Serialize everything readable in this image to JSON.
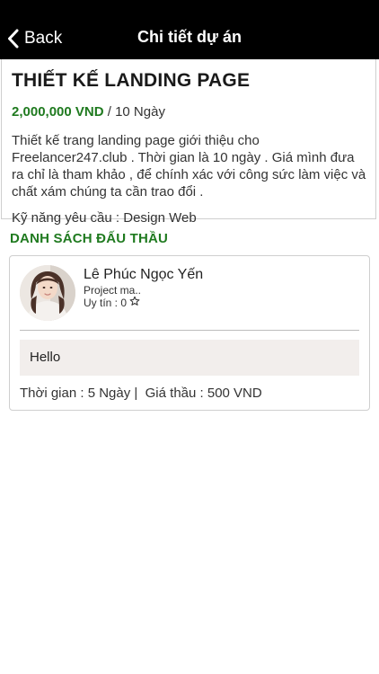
{
  "navbar": {
    "back_label": "Back",
    "title": "Chi tiết dự án",
    "back_icon": "chevron-left-icon"
  },
  "project": {
    "title": "THIẾT KẾ LANDING PAGE",
    "price": "2,000,000 VND",
    "duration": " / 10 Ngày",
    "description": "Thiết kế trang landing page giới thiệu cho Freelancer247.club . Thời gian là 10 ngày . Giá mình đưa ra chỉ là tham khảo , để chính xác với công sức làm việc và chất xám chúng ta cần trao đổi .",
    "skills": "Kỹ năng yêu cầu : Design Web"
  },
  "bids": {
    "heading": "DANH SÁCH ĐẤU THẦU",
    "items": [
      {
        "name": "Lê Phúc Ngọc Yến",
        "role": "Project ma..",
        "rating": "Uy tín : 0",
        "rating_icon": "star-outline-icon",
        "message": "Hello",
        "time": "Thời gian : 5 Ngày |",
        "bid_price": "Giá thầu : 500 VND"
      }
    ]
  },
  "colors": {
    "navbar_bg": "#000000",
    "accent_green": "#1f7a1f",
    "message_bg": "#f2eeec"
  }
}
